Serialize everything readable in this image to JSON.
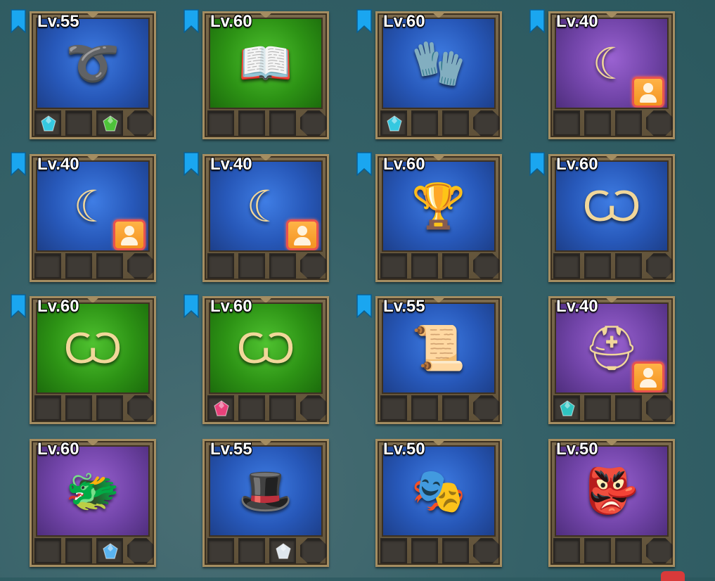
{
  "colors": {
    "bookmark": "#1aa6f0",
    "hero_badge": "#f39321",
    "gem_cyan": "#35c8e0",
    "gem_green": "#4ec33a",
    "gem_pink": "#e8417a",
    "gem_teal": "#2fc3c0",
    "gem_blue": "#5ab4f0",
    "gem_white": "#dfe7ee"
  },
  "items": [
    {
      "level": "Lv.55",
      "bg": "blue",
      "bookmark": true,
      "hero": false,
      "icon": "whip-icon",
      "glyph": "➰",
      "gems": [
        "cyan",
        "empty",
        "green",
        "empty"
      ]
    },
    {
      "level": "Lv.60",
      "bg": "green",
      "bookmark": true,
      "hero": false,
      "icon": "book-icon",
      "glyph": "📖",
      "gems": [
        "empty",
        "empty",
        "empty",
        "empty"
      ]
    },
    {
      "level": "Lv.60",
      "bg": "blue",
      "bookmark": true,
      "hero": false,
      "icon": "gauntlets-icon",
      "glyph": "🧤",
      "gems": [
        "cyan",
        "empty",
        "empty",
        "empty"
      ]
    },
    {
      "level": "Lv.40",
      "bg": "purple",
      "bookmark": true,
      "hero": true,
      "icon": "horn-amulet-icon",
      "glyph": "☾",
      "gems": [
        "empty",
        "empty",
        "empty",
        "empty"
      ]
    },
    {
      "level": "Lv.40",
      "bg": "blue",
      "bookmark": true,
      "hero": true,
      "icon": "horn-amulet-icon",
      "glyph": "☾",
      "gems": [
        "empty",
        "empty",
        "empty",
        "empty"
      ]
    },
    {
      "level": "Lv.40",
      "bg": "blue",
      "bookmark": true,
      "hero": true,
      "icon": "horn-amulet-icon",
      "glyph": "☾",
      "gems": [
        "empty",
        "empty",
        "empty",
        "empty"
      ]
    },
    {
      "level": "Lv.60",
      "bg": "blue",
      "bookmark": true,
      "hero": false,
      "icon": "chalice-icon",
      "glyph": "🏆",
      "gems": [
        "empty",
        "empty",
        "empty",
        "empty"
      ]
    },
    {
      "level": "Lv.60",
      "bg": "blue",
      "bookmark": true,
      "hero": false,
      "icon": "claw-amulet-icon",
      "glyph": "Ѡ",
      "gems": [
        "empty",
        "empty",
        "empty",
        "empty"
      ]
    },
    {
      "level": "Lv.60",
      "bg": "green",
      "bookmark": true,
      "hero": false,
      "icon": "claw-amulet-icon",
      "glyph": "Ѡ",
      "gems": [
        "empty",
        "empty",
        "empty",
        "empty"
      ]
    },
    {
      "level": "Lv.60",
      "bg": "green",
      "bookmark": true,
      "hero": false,
      "icon": "claw-amulet-icon",
      "glyph": "Ѡ",
      "gems": [
        "pink",
        "empty",
        "empty",
        "empty"
      ]
    },
    {
      "level": "Lv.55",
      "bg": "blue",
      "bookmark": true,
      "hero": false,
      "icon": "flaming-scroll-icon",
      "glyph": "📜",
      "gems": [
        "empty",
        "empty",
        "empty",
        "empty"
      ]
    },
    {
      "level": "Lv.40",
      "bg": "purple",
      "bookmark": false,
      "hero": true,
      "icon": "helmet-icon",
      "glyph": "⛑",
      "gems": [
        "teal",
        "empty",
        "empty",
        "empty"
      ]
    },
    {
      "level": "Lv.60",
      "bg": "purple",
      "bookmark": false,
      "hero": false,
      "icon": "dragon-helm-icon",
      "glyph": "🐲",
      "gems": [
        "empty",
        "empty",
        "blue",
        "empty"
      ]
    },
    {
      "level": "Lv.55",
      "bg": "blue",
      "bookmark": false,
      "hero": false,
      "icon": "witch-hat-icon",
      "glyph": "🎩",
      "gems": [
        "empty",
        "empty",
        "white",
        "empty"
      ]
    },
    {
      "level": "Lv.50",
      "bg": "blue",
      "bookmark": false,
      "hero": false,
      "icon": "mask-icon",
      "glyph": "🎭",
      "gems": [
        "empty",
        "empty",
        "empty",
        "empty"
      ]
    },
    {
      "level": "Lv.50",
      "bg": "purple",
      "bookmark": false,
      "hero": false,
      "icon": "tribal-mask-icon",
      "glyph": "👺",
      "gems": [
        "empty",
        "empty",
        "empty",
        "empty"
      ]
    }
  ]
}
